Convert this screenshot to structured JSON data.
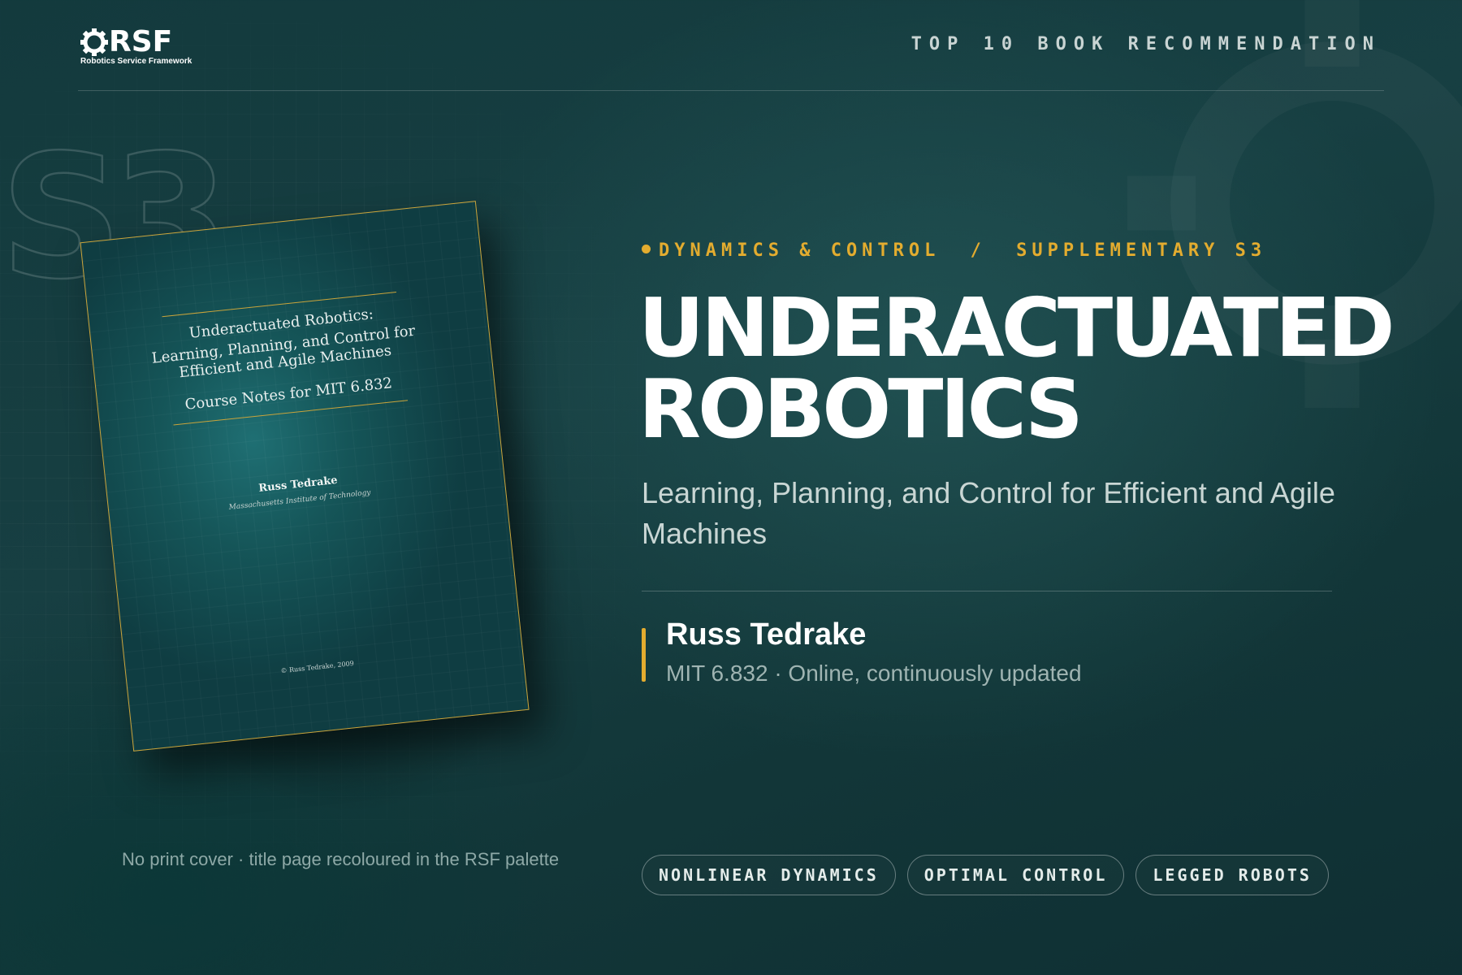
{
  "brand": {
    "logo_text": "RSF",
    "logo_subtitle": "Robotics Service Framework",
    "logo_icon": "gear-icon"
  },
  "header": {
    "tag": "TOP 10 BOOK RECOMMENDATION"
  },
  "watermark": {
    "text": "S3"
  },
  "book_cover": {
    "title_line1": "Underactuated Robotics:",
    "title_line2": "Learning, Planning, and Control for",
    "title_line3": "Efficient and Agile Machines",
    "course_line": "Course Notes for MIT 6.832",
    "author": "Russ Tedrake",
    "institution": "Massachusetts Institute of Technology",
    "copyright": "© Russ Tedrake, 2009"
  },
  "caption": "No print cover · title page recoloured in the RSF palette",
  "category": {
    "primary": "DYNAMICS & CONTROL",
    "separator": "/",
    "secondary": "SUPPLEMENTARY S3"
  },
  "title": {
    "line1": "UNDERACTUATED",
    "line2": "ROBOTICS"
  },
  "subtitle": "Learning, Planning, and Control for Efficient and Agile Machines",
  "author": {
    "name": "Russ Tedrake",
    "meta": "MIT 6.832 · Online, continuously updated"
  },
  "tags": [
    "NONLINEAR DYNAMICS",
    "OPTIMAL CONTROL",
    "LEGGED ROBOTS"
  ],
  "colors": {
    "accent": "#e3ac2f",
    "background": "#163c3f",
    "text": "#ffffff"
  }
}
